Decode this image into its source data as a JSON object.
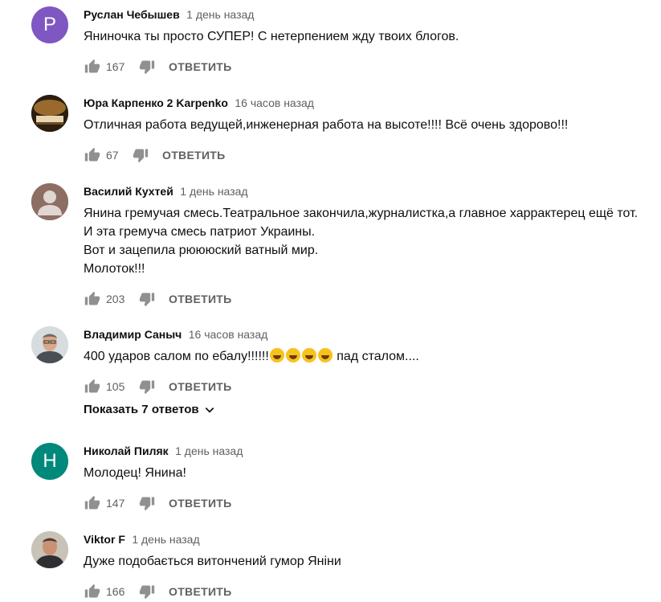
{
  "comments": [
    {
      "author": "Руслан Чебышев",
      "time": "1 день назад",
      "text": "Яниночка ты просто СУПЕР! С нетерпением жду твоих блогов.",
      "likes": "167",
      "reply": "ОТВЕТИТЬ",
      "avatar_letter": "Р",
      "avatar_color": "#7e57c2"
    },
    {
      "author": "Юра Карпенко 2 Karpenko",
      "time": "16 часов назад",
      "text": "Отличная работа ведущей,инженерная работа на высоте!!!!  Всё очень здорово!!!",
      "likes": "67",
      "reply": "ОТВЕТИТЬ"
    },
    {
      "author": "Василий Кухтей",
      "time": "1 день назад",
      "text": "Янина гремучая смесь.Театральное закончила,журналистка,а главное харрактерец ещё тот.\nИ эта гремуча смесь патриот Украины.\nВот и зацепила рюююский ватный мир.\nМолоток!!!",
      "likes": "203",
      "reply": "ОТВЕТИТЬ"
    },
    {
      "author": "Владимир Саныч",
      "time": "16 часов назад",
      "text_before": "400 ударов салом по ебалу!!!!!!",
      "text_after": " пад сталом....",
      "likes": "105",
      "reply": "ОТВЕТИТЬ",
      "show_replies": "Показать 7 ответов"
    },
    {
      "author": "Николай Пиляк",
      "time": "1 день назад",
      "text": "Молодец! Янина!",
      "likes": "147",
      "reply": "ОТВЕТИТЬ",
      "avatar_letter": "Н",
      "avatar_color": "#00897b"
    },
    {
      "author": "Viktor F",
      "time": "1 день назад",
      "text": "Дуже подобається витончений гумор Яніни",
      "likes": "166",
      "reply": "ОТВЕТИТЬ"
    }
  ],
  "icons": {
    "like": "thumb-up-icon",
    "dislike": "thumb-down-icon",
    "chevron": "chevron-down-icon",
    "emoji": "laughing-emoji-icon"
  },
  "colors": {
    "text_primary": "#0f0f0f",
    "text_secondary": "#606060"
  }
}
